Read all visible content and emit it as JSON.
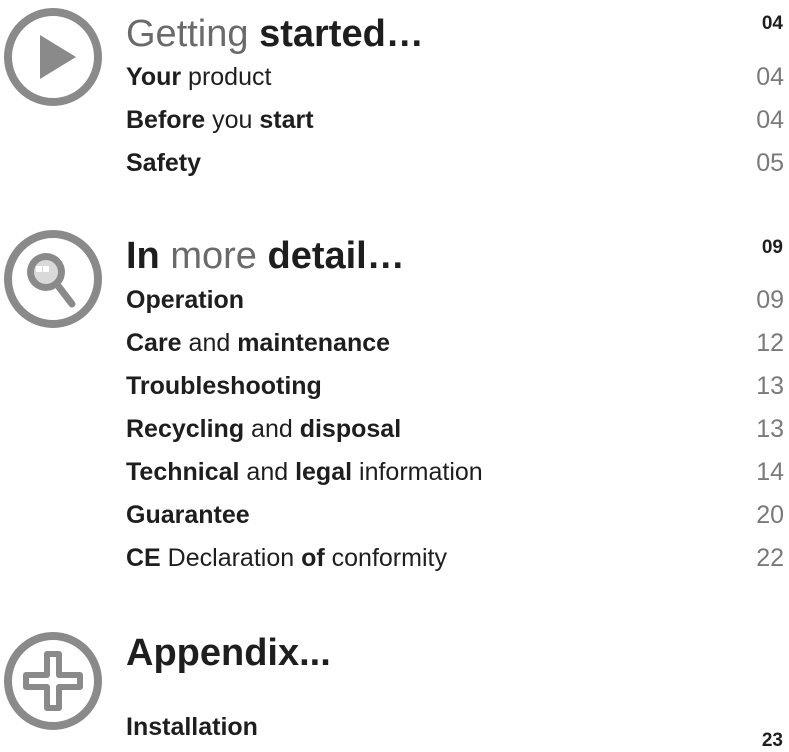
{
  "sections": [
    {
      "heading": [
        {
          "text": "Getting",
          "bold": false
        },
        {
          "text": " ",
          "bold": false
        },
        {
          "text": "started…",
          "bold": true
        }
      ],
      "heading_page": "04",
      "icon": "play-icon",
      "items": [
        {
          "parts": [
            {
              "text": "Your",
              "bold": true
            },
            {
              "text": " product",
              "bold": false
            }
          ],
          "page": "04"
        },
        {
          "parts": [
            {
              "text": "Before",
              "bold": true
            },
            {
              "text": " you ",
              "bold": false
            },
            {
              "text": "start",
              "bold": true
            }
          ],
          "page": "04"
        },
        {
          "parts": [
            {
              "text": "Safety",
              "bold": true
            }
          ],
          "page": "05"
        }
      ]
    },
    {
      "heading": [
        {
          "text": "In",
          "bold": true
        },
        {
          "text": " more ",
          "bold": false
        },
        {
          "text": "detail…",
          "bold": true
        }
      ],
      "heading_page": "09",
      "icon": "magnifier-icon",
      "items": [
        {
          "parts": [
            {
              "text": "Operation",
              "bold": true
            }
          ],
          "page": "09"
        },
        {
          "parts": [
            {
              "text": "Care",
              "bold": true
            },
            {
              "text": " and ",
              "bold": false
            },
            {
              "text": "maintenance",
              "bold": true
            }
          ],
          "page": "12"
        },
        {
          "parts": [
            {
              "text": "Troubleshooting",
              "bold": true
            }
          ],
          "page": "13"
        },
        {
          "parts": [
            {
              "text": "Recycling",
              "bold": true
            },
            {
              "text": " and ",
              "bold": false
            },
            {
              "text": "disposal",
              "bold": true
            }
          ],
          "page": "13"
        },
        {
          "parts": [
            {
              "text": "Technical",
              "bold": true
            },
            {
              "text": " and ",
              "bold": false
            },
            {
              "text": "legal",
              "bold": true
            },
            {
              "text": " information",
              "bold": false
            }
          ],
          "page": "14"
        },
        {
          "parts": [
            {
              "text": "Guarantee",
              "bold": true
            }
          ],
          "page": "20"
        },
        {
          "parts": [
            {
              "text": "CE",
              "bold": true
            },
            {
              "text": " Declaration ",
              "bold": false
            },
            {
              "text": "of",
              "bold": true
            },
            {
              "text": " conformity",
              "bold": false
            }
          ],
          "page": "22"
        }
      ]
    },
    {
      "heading": [
        {
          "text": "Appendix...",
          "bold": true
        }
      ],
      "heading_page": "",
      "icon": "plus-icon",
      "items": [
        {
          "parts": [
            {
              "text": "Installation",
              "bold": true
            }
          ],
          "page": "23"
        }
      ]
    }
  ],
  "colors": {
    "icon": "#8a8a8a",
    "text": "#1e1e1e",
    "page_number": "#7a7a7a"
  }
}
